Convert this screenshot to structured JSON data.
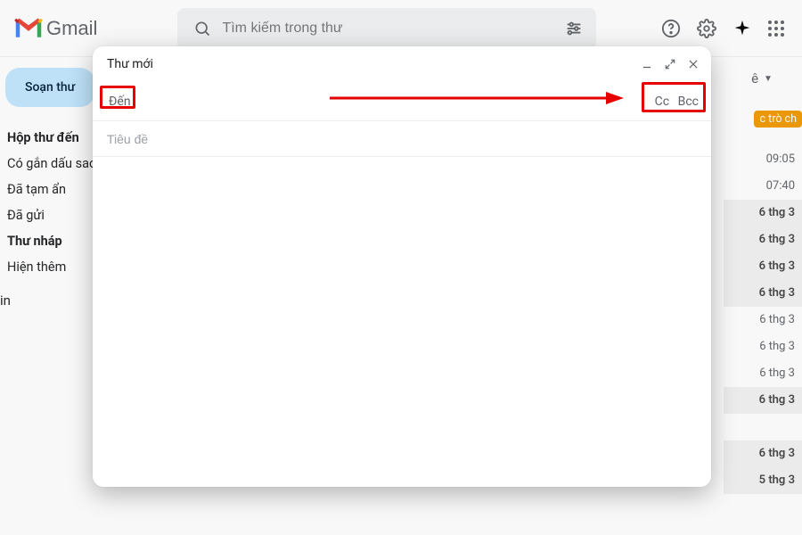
{
  "header": {
    "product": "Gmail",
    "search_placeholder": "Tìm kiếm trong thư"
  },
  "sidebar": {
    "compose": "Soạn thư",
    "items": [
      {
        "label": "Hộp thư đến",
        "bold": true
      },
      {
        "label": "Có gắn dấu sao",
        "bold": false
      },
      {
        "label": "Đã tạm ẩn",
        "bold": false
      },
      {
        "label": "Đã gửi",
        "bold": false
      },
      {
        "label": "Thư nháp",
        "bold": true
      },
      {
        "label": "Hiện thêm",
        "bold": false
      }
    ],
    "extra": "in"
  },
  "rightcol": {
    "short_e": "ê",
    "chip": "c trò ch",
    "rows": [
      {
        "text": "09:05",
        "band": false
      },
      {
        "text": "07:40",
        "band": false
      },
      {
        "text": "6 thg 3",
        "band": true
      },
      {
        "text": "6 thg 3",
        "band": true
      },
      {
        "text": "6 thg 3",
        "band": true
      },
      {
        "text": "6 thg 3",
        "band": true
      },
      {
        "text": "6 thg 3",
        "band": false
      },
      {
        "text": "6 thg 3",
        "band": false
      },
      {
        "text": "6 thg 3",
        "band": false
      },
      {
        "text": "6 thg 3",
        "band": true
      },
      {
        "text": "",
        "band": false
      },
      {
        "text": "6 thg 3",
        "band": true
      },
      {
        "text": "5 thg 3",
        "band": true
      }
    ]
  },
  "compose": {
    "title": "Thư mới",
    "to_label": "Đến",
    "cc": "Cc",
    "bcc": "Bcc",
    "subject_placeholder": "Tiêu đề"
  }
}
